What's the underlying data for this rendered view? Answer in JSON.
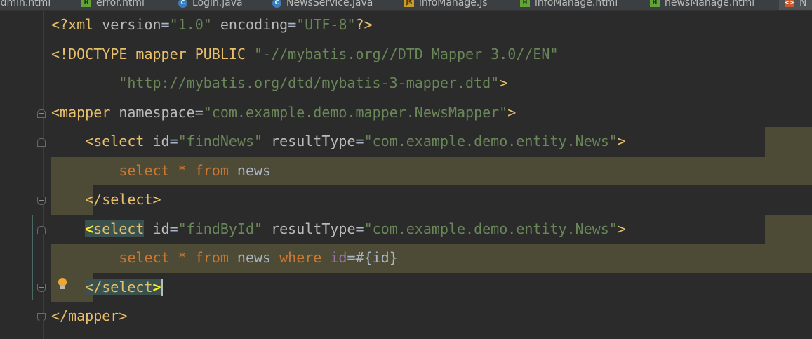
{
  "tabs": [
    {
      "label": "admin.html",
      "icon": "html-file-icon"
    },
    {
      "label": "error.html",
      "icon": "html-file-icon"
    },
    {
      "label": "Login.java",
      "icon": "java-class-icon"
    },
    {
      "label": "NewsService.java",
      "icon": "java-class-icon"
    },
    {
      "label": "infoManage.js",
      "icon": "js-file-icon"
    },
    {
      "label": "infoManage.html",
      "icon": "html-file-icon"
    },
    {
      "label": "newsManage.html",
      "icon": "html-file-icon"
    },
    {
      "label": "N",
      "icon": "xml-file-icon"
    }
  ],
  "code": {
    "l1": {
      "a": "<?xml ",
      "b": "version",
      "c": "=",
      "d": "\"1.0\"",
      "e": " ",
      "f": "encoding",
      "g": "=",
      "h": "\"UTF-8\"",
      "i": "?>"
    },
    "l2": {
      "a": "<!DOCTYPE ",
      "b": "mapper ",
      "c": "PUBLIC ",
      "d": "\"-//mybatis.org//DTD Mapper 3.0//EN\""
    },
    "l3": {
      "a": "        \"http://mybatis.org/dtd/mybatis-3-mapper.dtd\"",
      "b": ">"
    },
    "l4": {
      "a": "<mapper ",
      "b": "namespace",
      "c": "=",
      "d": "\"com.example.demo.mapper.NewsMapper\"",
      "e": ">"
    },
    "l5": {
      "a": "    <select ",
      "b": "id",
      "c": "=",
      "d": "\"findNews\"",
      "e": " resultType",
      "f": "=",
      "g": "\"com.example.demo.entity.News\"",
      "h": ">"
    },
    "l6": {
      "a": "        ",
      "b": "select",
      "c": " * ",
      "d": "from",
      "e": " news"
    },
    "l7": {
      "a": "    </select>"
    },
    "l8": {
      "a": "    ",
      "b": "<",
      "c": "select",
      "d": " id",
      "e": "=",
      "f": "\"findById\"",
      "g": " resultType",
      "h": "=",
      "i": "\"com.example.demo.entity.News\"",
      "j": ">"
    },
    "l9": {
      "a": "        ",
      "b": "select",
      "c": " * ",
      "d": "from",
      "e": " news ",
      "f": "where",
      "g": " ",
      "h": "id",
      "i": "=#{id}"
    },
    "l10": {
      "a": "    ",
      "b": "</select",
      "c": ">"
    },
    "l11": {
      "a": "</mapper>"
    }
  },
  "colors": {
    "background": "#2b2b2b",
    "tag": "#e8bf6a",
    "string": "#6a8759",
    "keyword": "#cc7832",
    "highlight": "#4d4a36",
    "bracket_match": "#ffef28"
  }
}
